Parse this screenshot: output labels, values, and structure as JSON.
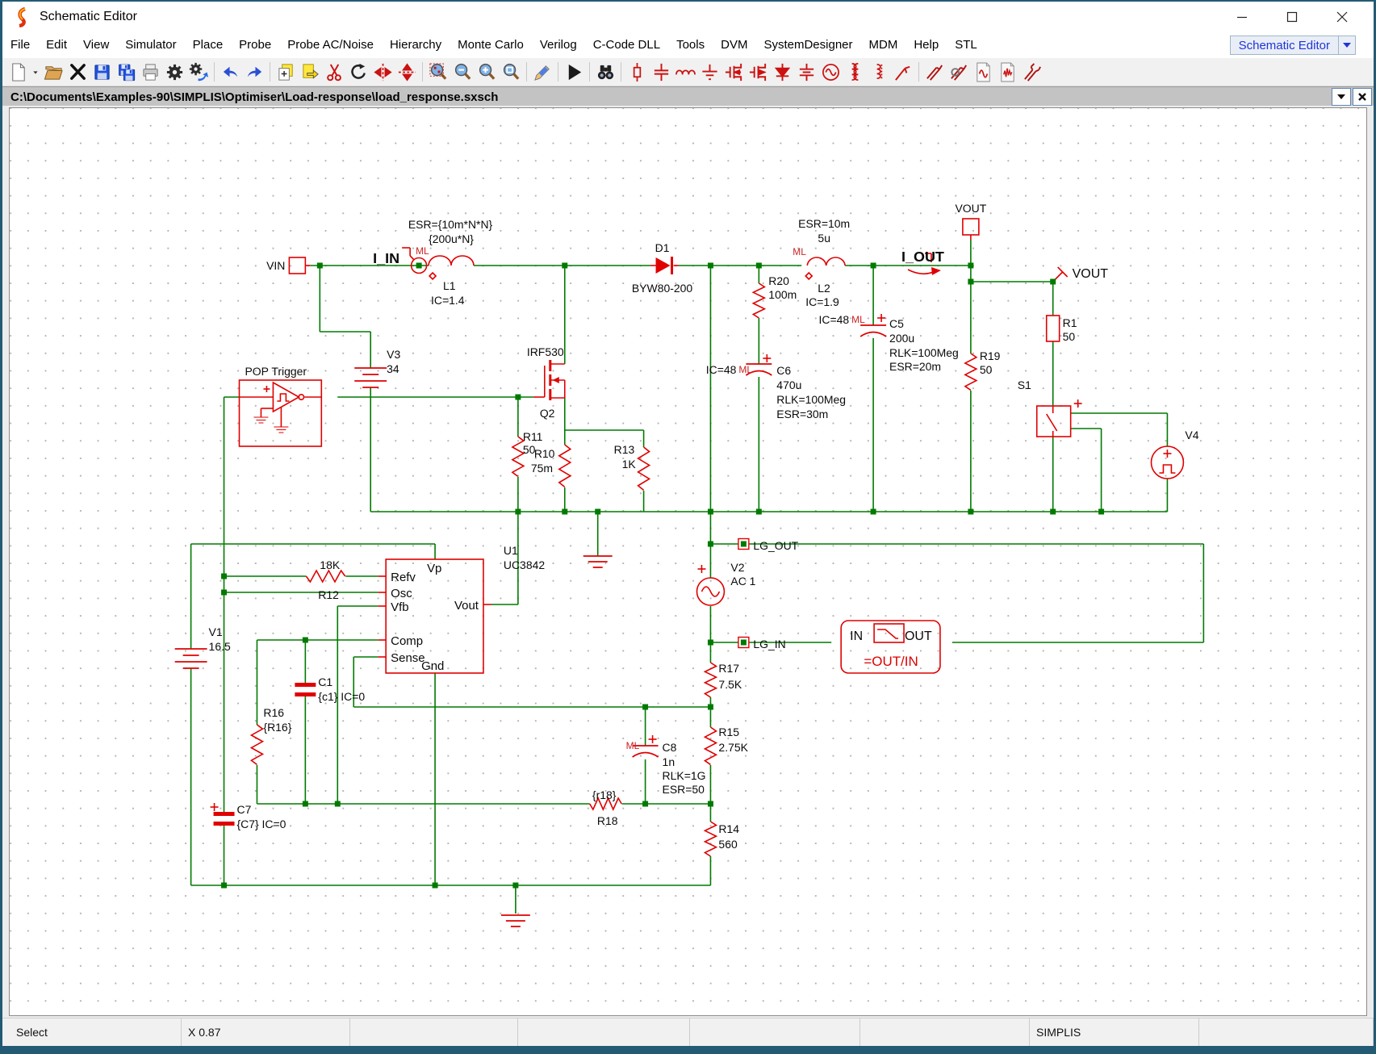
{
  "titlebar": {
    "title": "Schematic Editor"
  },
  "menubar": {
    "items": [
      "File",
      "Edit",
      "View",
      "Simulator",
      "Place",
      "Probe",
      "Probe AC/Noise",
      "Hierarchy",
      "Monte Carlo",
      "Verilog",
      "C-Code DLL",
      "Tools",
      "DVM",
      "SystemDesigner",
      "MDM",
      "Help",
      "STL"
    ],
    "mode_selector": "Schematic Editor"
  },
  "toolbar": {
    "groups": [
      [
        "new",
        "new-dropdown",
        "open",
        "delete",
        "save",
        "save-all",
        "print",
        "settings",
        "settings-run"
      ],
      [
        "undo",
        "redo"
      ],
      [
        "copy-page",
        "export-page",
        "cut",
        "rotate",
        "flip-vertical",
        "flip-horizontal"
      ],
      [
        "zoom-select",
        "zoom-out",
        "zoom-in",
        "zoom-area"
      ],
      [
        "edit-pencil"
      ],
      [
        "run-simulation"
      ],
      [
        "find"
      ],
      [
        "place-resistor",
        "place-capacitor",
        "place-inductor",
        "place-ground",
        "place-nmos",
        "place-pmos",
        "place-diode",
        "place-polarized-capacitor",
        "place-ac-source",
        "place-transformer",
        "place-coupled-inductor",
        "place-probe"
      ],
      [
        "voltage-probe",
        "current-probe",
        "ac-analysis-probe",
        "transient-probe",
        "differential-probe"
      ]
    ]
  },
  "pathbar": {
    "path": "C:\\Documents\\Examples-90\\SIMPLIS\\Optimiser\\Load-response\\load_response.sxsch"
  },
  "statusbar": {
    "segments": [
      "Select",
      "X 0.87",
      "",
      "",
      "",
      "",
      "SIMPLIS",
      ""
    ]
  },
  "schematic": {
    "labels": {
      "vin": "VIN",
      "i_in": "I_IN",
      "l1_esr": "ESR={10m*N*N}",
      "l1_esr2": "{200u*N}",
      "l1_ml": "ML",
      "l1_name": "L1",
      "l1_ic": "IC=1.4",
      "v3_name": "V3",
      "v3_val": "34",
      "pop": "POP Trigger",
      "d1_name": "D1",
      "d1_val": "BYW80-200",
      "q2_model": "IRF530",
      "q2_name": "Q2",
      "r11_name": "R11",
      "r11_val": "50",
      "r10_name": "R10",
      "r10_val": "75m",
      "r13_name": "R13",
      "r13_val": "1K",
      "r20_name": "R20",
      "r20_val": "100m",
      "l2_esr": "ESR=10m",
      "l2_val": "5u",
      "l2_ml": "ML",
      "l2_name": "L2",
      "l2_ic": "IC=1.9",
      "c6_ic": "IC=48",
      "c6_ml": "ML",
      "c6_name": "C6",
      "c6_val": "470u",
      "c6_rlk": "RLK=100Meg",
      "c6_esr": "ESR=30m",
      "c5_ic": "IC=48",
      "c5_ml": "ML",
      "c5_name": "C5",
      "c5_val": "200u",
      "c5_rlk": "RLK=100Meg",
      "c5_esr": "ESR=20m",
      "vout_term": "VOUT",
      "i_out": "I_OUT",
      "vout_probe": "VOUT",
      "r19_name": "R19",
      "r19_val": "50",
      "r1_name": "R1",
      "r1_val": "50",
      "s1_name": "S1",
      "v4_name": "V4",
      "u1_name": "U1",
      "u1_model": "UC3842",
      "pin_refv": "Refv",
      "pin_osc": "Osc",
      "pin_vfb": "Vfb",
      "pin_comp": "Comp",
      "pin_sense": "Sense",
      "pin_vp": "Vp",
      "pin_vout": "Vout",
      "pin_gnd": "Gnd",
      "r12_val": "18K",
      "r12_name": "R12",
      "v1_name": "V1",
      "v1_val": "16.5",
      "c1_name": "C1",
      "c1_val": "{c1} IC=0",
      "r16_name": "R16",
      "r16_val": "{R16}",
      "c7_name": "C7",
      "c7_val": "{C7} IC=0",
      "lg_out": "LG_OUT",
      "v2_name": "V2",
      "v2_val": "AC 1",
      "lg_in": "LG_IN",
      "blk_in": "IN",
      "blk_out": "OUT",
      "blk_eq": "=OUT/IN",
      "r17_name": "R17",
      "r17_val": "7.5K",
      "r15_name": "R15",
      "r15_val": "2.75K",
      "c8_ml": "ML",
      "c8_name": "C8",
      "c8_val": "1n",
      "c8_rlk": "RLK=1G",
      "c8_esr": "ESR=50",
      "r18_val": "{r18}",
      "r18_name": "R18",
      "r14_name": "R14",
      "r14_val": "560"
    }
  }
}
